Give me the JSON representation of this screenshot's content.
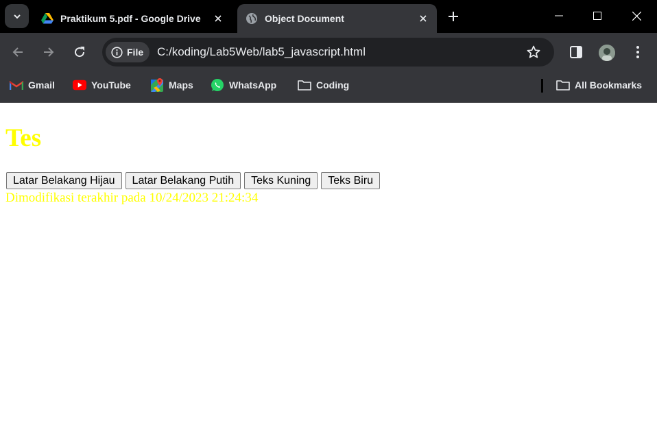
{
  "tabs": [
    {
      "title": "Praktikum 5.pdf - Google Drive",
      "icon": "google-drive-icon",
      "active": false
    },
    {
      "title": "Object Document",
      "icon": "globe-icon",
      "active": true
    }
  ],
  "address_bar": {
    "chip_label": "File",
    "url": "C:/koding/Lab5Web/lab5_javascript.html"
  },
  "bookmarks": [
    {
      "label": "Gmail",
      "icon": "gmail-icon"
    },
    {
      "label": "YouTube",
      "icon": "youtube-icon"
    },
    {
      "label": "Maps",
      "icon": "maps-icon"
    },
    {
      "label": "WhatsApp",
      "icon": "whatsapp-icon"
    },
    {
      "label": "Coding",
      "icon": "folder-icon"
    }
  ],
  "all_bookmarks": "All Bookmarks",
  "page": {
    "heading": "Tes",
    "heading_color": "#ffff00",
    "buttons": [
      "Latar Belakang Hijau",
      "Latar Belakang Putih",
      "Teks Kuning",
      "Teks Biru"
    ],
    "modified_text": "Dimodifikasi terakhir pada 10/24/2023 21:24:34",
    "text_color": "#ffff00"
  },
  "colors": {
    "titlebar": "#000000",
    "toolbar": "#35363a",
    "omnibox": "#202124"
  }
}
